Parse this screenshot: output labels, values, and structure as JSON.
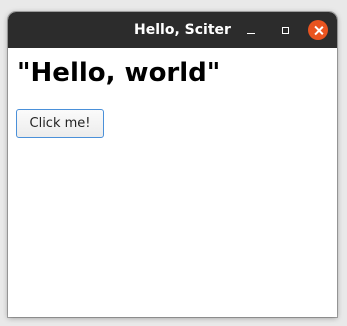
{
  "window": {
    "title": "Hello, Sciter",
    "controls": {
      "minimize_icon": "minimize-icon",
      "maximize_icon": "maximize-icon",
      "close_icon": "close-icon",
      "close_color": "#e95420"
    }
  },
  "main": {
    "heading": "\"Hello, world\"",
    "button_label": "Click me!"
  },
  "colors": {
    "titlebar": "#2c2c2c",
    "button_border": "#4a90d9"
  }
}
